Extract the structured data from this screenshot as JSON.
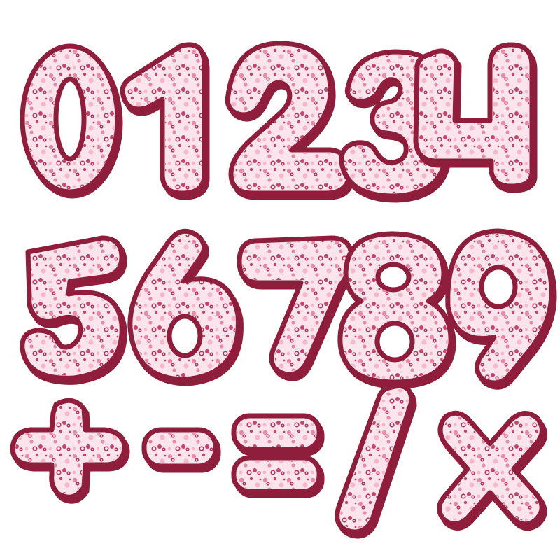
{
  "glyphs": [
    {
      "id": "zero",
      "char": "0"
    },
    {
      "id": "one",
      "char": "1"
    },
    {
      "id": "two",
      "char": "2"
    },
    {
      "id": "three",
      "char": "3"
    },
    {
      "id": "four",
      "char": "4"
    },
    {
      "id": "five",
      "char": "5"
    },
    {
      "id": "six",
      "char": "6"
    },
    {
      "id": "seven",
      "char": "7"
    },
    {
      "id": "eight",
      "char": "8"
    },
    {
      "id": "nine",
      "char": "9"
    },
    {
      "id": "plus",
      "char": "+"
    },
    {
      "id": "minus",
      "char": "-"
    },
    {
      "id": "equals",
      "char": "="
    },
    {
      "id": "slash",
      "char": "/"
    },
    {
      "id": "times",
      "char": "x"
    }
  ],
  "colors": {
    "outline": "#8e1e3c",
    "fill": "#fbe4ec",
    "dots": [
      "#e58aa7",
      "#c2456c",
      "#f4b8ca"
    ]
  }
}
